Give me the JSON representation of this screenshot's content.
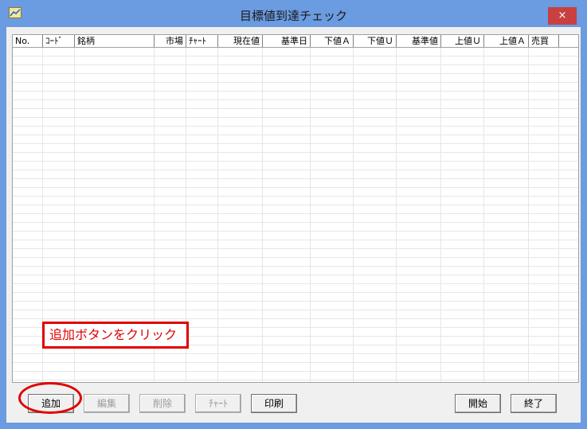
{
  "window": {
    "title": "目標値到達チェック",
    "close_label": "×"
  },
  "grid": {
    "columns": [
      "No.",
      "ｺｰﾄﾞ",
      "銘柄",
      "市場",
      "ﾁｬｰﾄ",
      "現在値",
      "基準日",
      "下値Ａ",
      "下値Ｕ",
      "基準値",
      "上値Ｕ",
      "上値Ａ",
      "売買"
    ]
  },
  "buttons": {
    "add": "追加",
    "edit": "編集",
    "delete": "削除",
    "chart": "ﾁｬｰﾄ",
    "print": "印刷",
    "start": "開始",
    "end": "終了"
  },
  "annotation": {
    "text": "追加ボタンをクリック"
  },
  "colors": {
    "titlebar": "#6b9be0",
    "close": "#c84040",
    "annotation": "#e00000"
  }
}
